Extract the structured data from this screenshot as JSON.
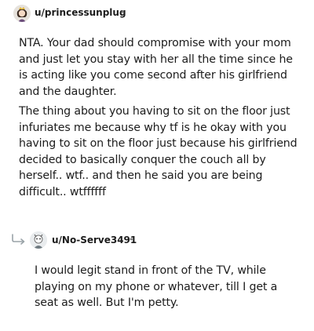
{
  "comment": {
    "username": "u/princessunplug",
    "separator": "•",
    "avatar_icon": "avatar-princess-icon",
    "paragraphs": [
      "NTA. Your dad should compromise with your mom and just let you stay with her all the time since he is acting like you come second after his girlfriend and the daughter.",
      "The thing about you having to sit on the floor just infuriates me because why tf is he okay with you having to sit on the floor just because his girlfriend decided to basically conquer the couch all by herself.. wtf.. and then he said you are being difficult.. wtffffff"
    ]
  },
  "reply": {
    "username": "u/No-Serve3491",
    "separator": "•",
    "avatar_icon": "avatar-no-serve-icon",
    "thread_icon": "reply-arrow-icon",
    "paragraphs": [
      "I would legit stand in front of the TV, while playing on my phone or whatever, till I get a seat as well. But I'm petty."
    ]
  }
}
